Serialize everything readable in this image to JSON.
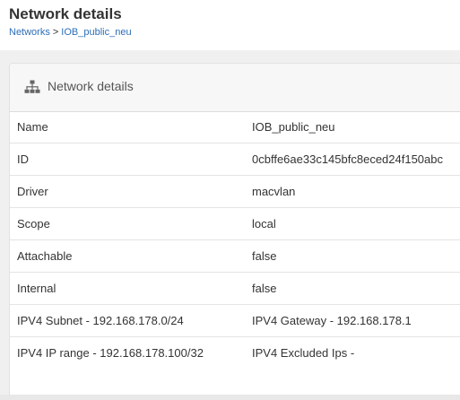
{
  "page": {
    "title": "Network details",
    "breadcrumb": {
      "root": "Networks",
      "separator": ">",
      "current": "IOB_public_neu"
    }
  },
  "panel": {
    "icon": "sitemap-icon",
    "title": "Network details"
  },
  "details": [
    {
      "key": "Name",
      "value": "IOB_public_neu"
    },
    {
      "key": "ID",
      "value": "0cbffe6ae33c145bfc8eced24f150abc"
    },
    {
      "key": "Driver",
      "value": "macvlan"
    },
    {
      "key": "Scope",
      "value": "local"
    },
    {
      "key": "Attachable",
      "value": "false"
    },
    {
      "key": "Internal",
      "value": "false"
    },
    {
      "key": "IPV4 Subnet - 192.168.178.0/24",
      "value": "IPV4 Gateway - 192.168.178.1"
    },
    {
      "key": "IPV4 IP range - 192.168.178.100/32",
      "value": "IPV4 Excluded Ips -"
    }
  ],
  "colors": {
    "link": "#2c6eb8",
    "panel_header_bg": "#f7f7f7",
    "page_bg": "#f0f0f0"
  }
}
